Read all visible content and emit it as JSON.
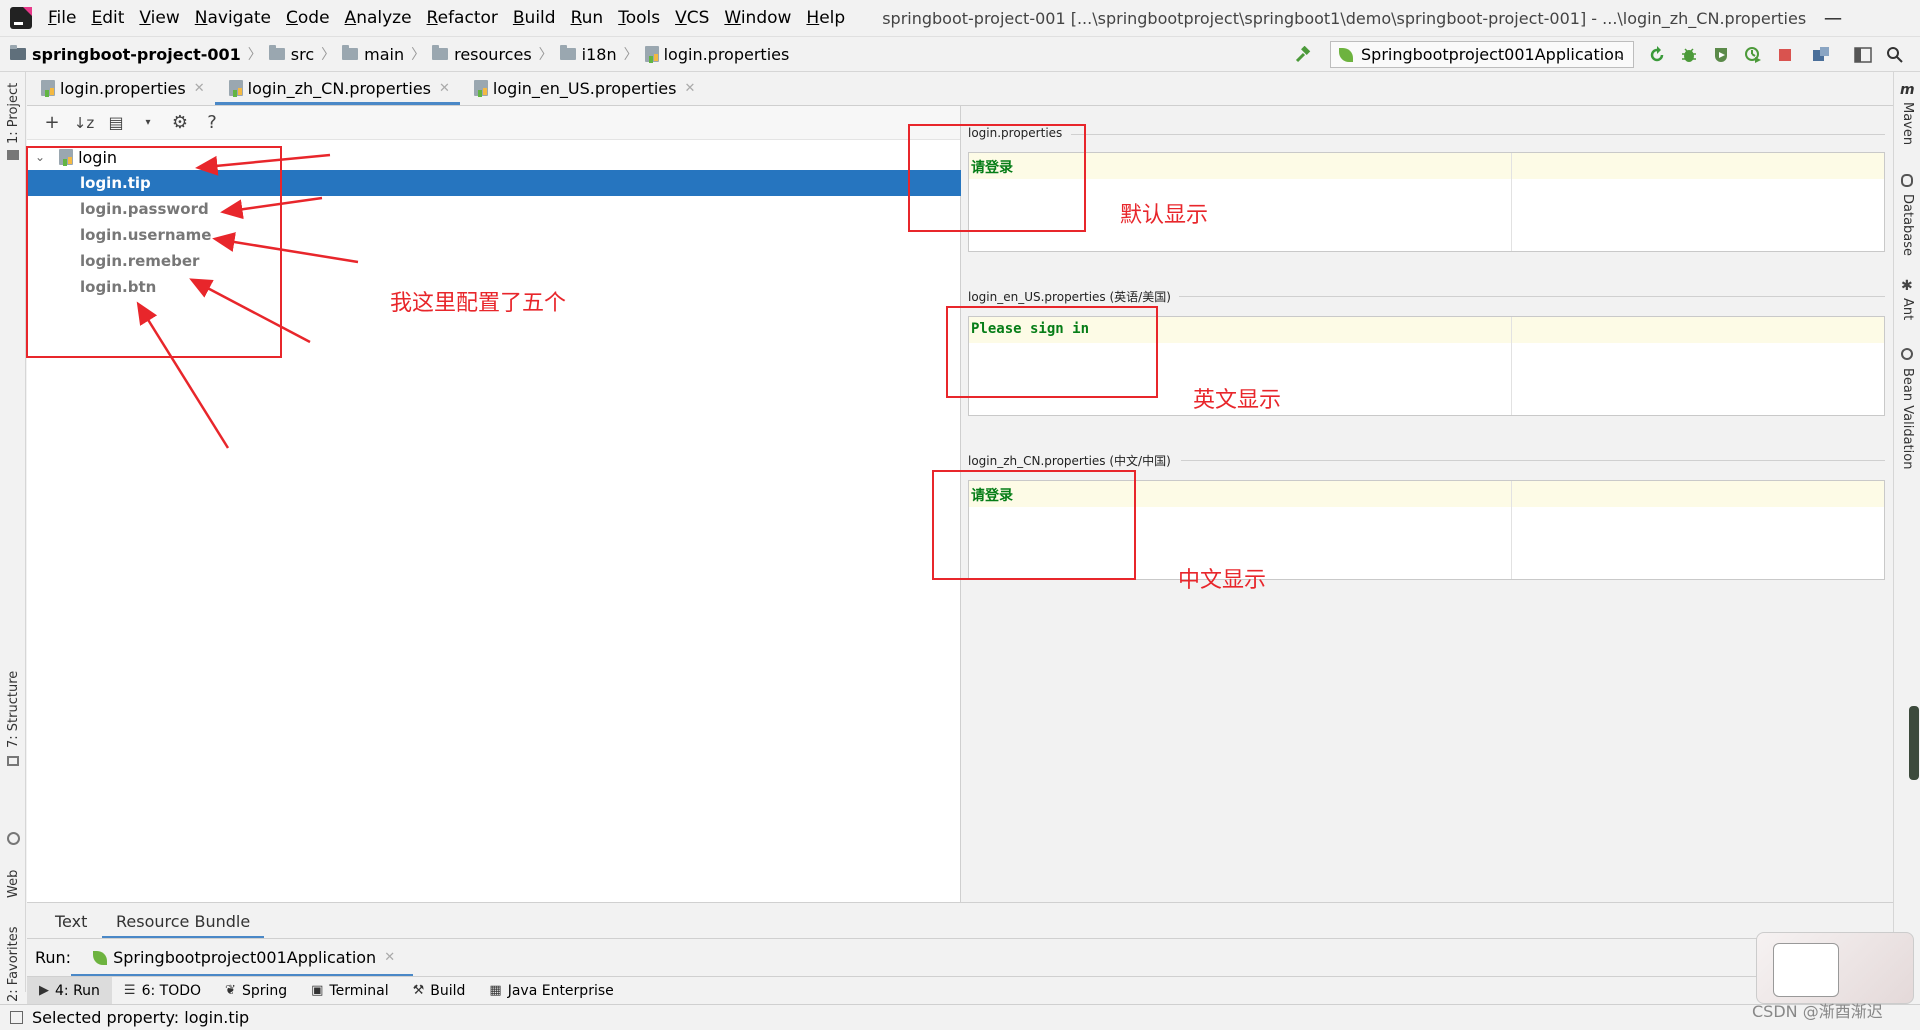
{
  "menubar": {
    "items": [
      "File",
      "Edit",
      "View",
      "Navigate",
      "Code",
      "Analyze",
      "Refactor",
      "Build",
      "Run",
      "Tools",
      "VCS",
      "Window",
      "Help"
    ],
    "window_title": "springboot-project-001 [...\\springbootproject\\springboot1\\demo\\springboot-project-001] - ...\\login_zh_CN.properties"
  },
  "window_controls": {
    "minimize": "—",
    "restore": "❐",
    "close": "✕"
  },
  "breadcrumb": [
    "springboot-project-001",
    "src",
    "main",
    "resources",
    "i18n",
    "login.properties"
  ],
  "run_config": {
    "label": "Springbootproject001Application"
  },
  "editor_tabs": [
    {
      "label": "login.properties",
      "active": false
    },
    {
      "label": "login_zh_CN.properties",
      "active": true
    },
    {
      "label": "login_en_US.properties",
      "active": false
    }
  ],
  "tree": {
    "root": "login",
    "items": [
      "login.tip",
      "login.password",
      "login.username",
      "login.remeber",
      "login.btn"
    ],
    "selected": "login.tip"
  },
  "editors": [
    {
      "file": "login.properties",
      "value": "请登录"
    },
    {
      "file": "login_en_US.properties (英语/美国)",
      "value": "Please sign in"
    },
    {
      "file": "login_zh_CN.properties (中文/中国)",
      "value": "请登录"
    }
  ],
  "mode_tabs": [
    "Text",
    "Resource Bundle"
  ],
  "run_bar": {
    "label": "Run:",
    "tab": "Springbootproject001Application"
  },
  "tool_windows": [
    "4: Run",
    "6: TODO",
    "Spring",
    "Terminal",
    "Build",
    "Java Enterprise"
  ],
  "left_strip": [
    "1: Project",
    "7: Structure",
    "Web",
    "2: Favorites"
  ],
  "right_strip": [
    "Maven",
    "Database",
    "Ant",
    "Bean Validation"
  ],
  "status": "Selected property: login.tip",
  "annotations": {
    "tree_note": "我这里配置了五个",
    "default_note": "默认显示",
    "english_note": "英文显示",
    "chinese_note": "中文显示"
  },
  "watermark": "CSDN @渐酉渐迟",
  "colors": {
    "accent": "#2675bf",
    "annotation": "#e8262b",
    "value_green": "#067d17",
    "highlight_row": "#fdfbe6"
  }
}
